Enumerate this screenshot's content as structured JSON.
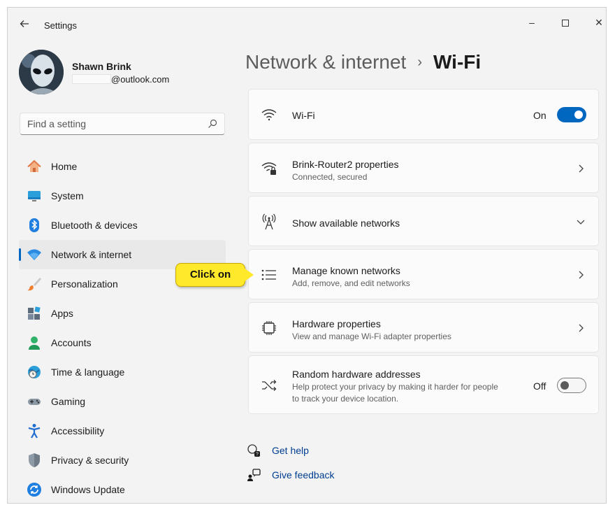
{
  "window": {
    "title": "Settings",
    "back_icon": "back-arrow-icon",
    "controls": {
      "minimize": "–",
      "close": "✕"
    }
  },
  "user": {
    "name": "Shawn Brink",
    "email_suffix": "@outlook.com"
  },
  "search": {
    "placeholder": "Find a setting"
  },
  "nav": {
    "items": [
      {
        "label": "Home",
        "icon": "home-icon"
      },
      {
        "label": "System",
        "icon": "monitor-icon"
      },
      {
        "label": "Bluetooth & devices",
        "icon": "bluetooth-icon"
      },
      {
        "label": "Network & internet",
        "icon": "wifi-icon",
        "active": true
      },
      {
        "label": "Personalization",
        "icon": "paintbrush-icon"
      },
      {
        "label": "Apps",
        "icon": "apps-icon"
      },
      {
        "label": "Accounts",
        "icon": "person-icon"
      },
      {
        "label": "Time & language",
        "icon": "globe-clock-icon"
      },
      {
        "label": "Gaming",
        "icon": "gamepad-icon"
      },
      {
        "label": "Accessibility",
        "icon": "accessibility-icon"
      },
      {
        "label": "Privacy & security",
        "icon": "shield-icon"
      },
      {
        "label": "Windows Update",
        "icon": "update-icon"
      }
    ]
  },
  "header": {
    "parent": "Network & internet",
    "separator": "›",
    "current": "Wi-Fi"
  },
  "cards": {
    "wifi": {
      "title": "Wi-Fi",
      "state": "On"
    },
    "properties": {
      "title": "Brink-Router2 properties",
      "subtitle": "Connected, secured"
    },
    "available": {
      "title": "Show available networks"
    },
    "known": {
      "title": "Manage known networks",
      "subtitle": "Add, remove, and edit networks"
    },
    "hardware": {
      "title": "Hardware properties",
      "subtitle": "View and manage Wi-Fi adapter properties"
    },
    "random": {
      "title": "Random hardware addresses",
      "subtitle_line1": "Help protect your privacy by making it harder for people",
      "subtitle_line2": "to track your device location.",
      "state": "Off"
    }
  },
  "callout": {
    "text": "Click on"
  },
  "links": {
    "help": "Get help",
    "feedback": "Give feedback"
  },
  "colors": {
    "accent": "#0067c0",
    "callout": "#ffe92a",
    "link": "#003e92"
  }
}
